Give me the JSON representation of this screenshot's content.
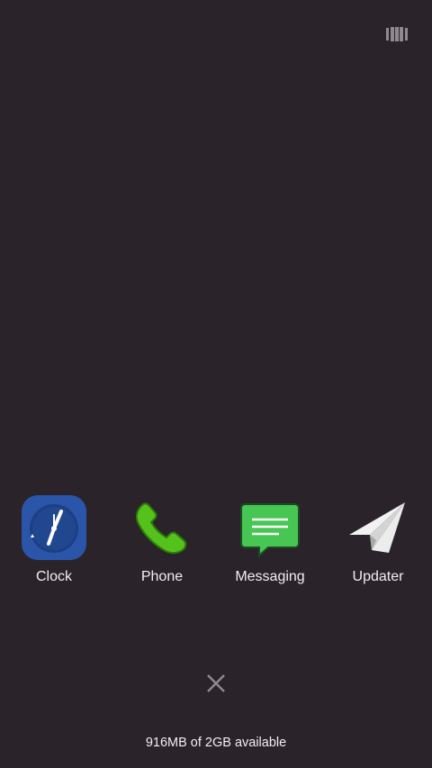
{
  "toolbar": {
    "layout_toggle_icon": "layout-toggle-icon"
  },
  "recent_apps": [
    {
      "label": "Clock",
      "icon": "clock-icon",
      "color": "#2550a3"
    },
    {
      "label": "Phone",
      "icon": "phone-icon",
      "color": "#4fbf1c"
    },
    {
      "label": "Messaging",
      "icon": "message-icon",
      "color": "#47c552"
    },
    {
      "label": "Updater",
      "icon": "paper-plane-icon",
      "color": "#ececec"
    }
  ],
  "close_all": {
    "icon": "close-icon"
  },
  "memory": {
    "status": "916MB of 2GB available"
  },
  "colors": {
    "background": "#2b232a",
    "text": "#f2eef1",
    "icon_gray": "#8f8a8e"
  }
}
